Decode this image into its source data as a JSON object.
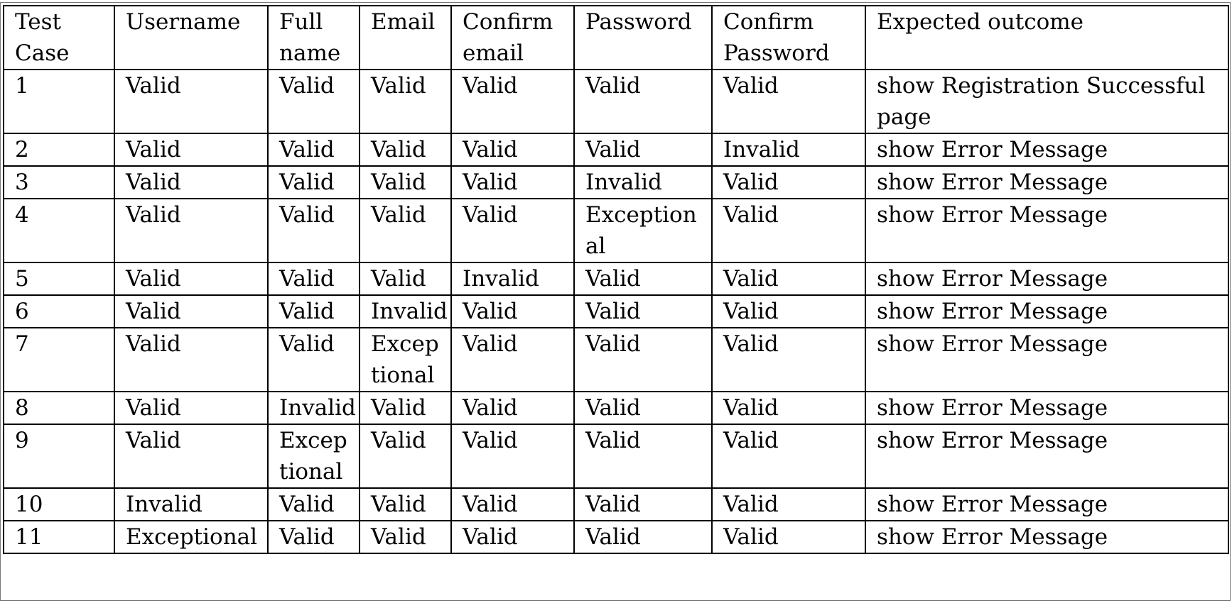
{
  "table": {
    "headers": [
      "Test Case",
      "Username",
      "Full name",
      "Email",
      "Confirm email",
      "Password",
      "Confirm Password",
      "Expected outcome"
    ],
    "rows": [
      [
        "1",
        "Valid",
        "Valid",
        "Valid",
        "Valid",
        "Valid",
        "Valid",
        "show Registration Successful page"
      ],
      [
        "2",
        "Valid",
        "Valid",
        "Valid",
        "Valid",
        "Valid",
        "Invalid",
        "show Error Message"
      ],
      [
        "3",
        "Valid",
        "Valid",
        "Valid",
        "Valid",
        "Invalid",
        "Valid",
        "show Error Message"
      ],
      [
        "4",
        "Valid",
        "Valid",
        "Valid",
        "Valid",
        "Exceptional",
        "Valid",
        "show Error Message"
      ],
      [
        "5",
        "Valid",
        "Valid",
        "Valid",
        "Invalid",
        "Valid",
        "Valid",
        "show Error Message"
      ],
      [
        "6",
        "Valid",
        "Valid",
        "Invalid",
        "Valid",
        "Valid",
        "Valid",
        "show Error Message"
      ],
      [
        "7",
        "Valid",
        "Valid",
        "Exceptional",
        "Valid",
        "Valid",
        "Valid",
        "show Error Message"
      ],
      [
        "8",
        "Valid",
        "Invalid",
        "Valid",
        "Valid",
        "Valid",
        "Valid",
        "show Error Message"
      ],
      [
        "9",
        "Valid",
        "Exceptional",
        "Valid",
        "Valid",
        "Valid",
        "Valid",
        "show Error Message"
      ],
      [
        "10",
        "Invalid",
        "Valid",
        "Valid",
        "Valid",
        "Valid",
        "Valid",
        "show Error Message"
      ],
      [
        "11",
        "Exceptional",
        "Valid",
        "Valid",
        "Valid",
        "Valid",
        "Valid",
        "show Error Message"
      ]
    ]
  }
}
